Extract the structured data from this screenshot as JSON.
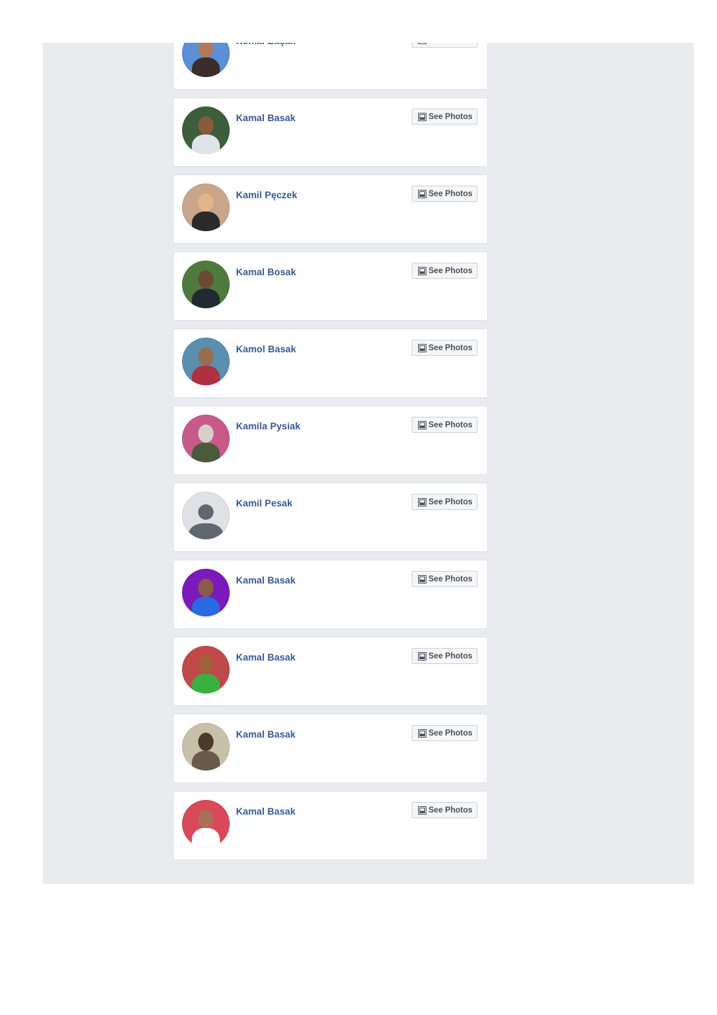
{
  "button_label": "See Photos",
  "results": [
    {
      "name": "Kemal Başak",
      "avatar": {
        "bg": "#5b8fd6",
        "head": "#b07a5a",
        "body": "#3a2e2c"
      }
    },
    {
      "name": "Kamal Basak",
      "avatar": {
        "bg": "#3d5e3a",
        "head": "#8a5a3c",
        "body": "#dfe4ea"
      }
    },
    {
      "name": "Kamil Pęczek",
      "avatar": {
        "bg": "#c9a58a",
        "head": "#e4b48a",
        "body": "#2a2a2a"
      }
    },
    {
      "name": "Kamal Bosak",
      "avatar": {
        "bg": "#4f7a3f",
        "head": "#6b4a33",
        "body": "#1f2a33"
      }
    },
    {
      "name": "Kamol Basak",
      "avatar": {
        "bg": "#5a8fb0",
        "head": "#9a6b4e",
        "body": "#b03040"
      }
    },
    {
      "name": "Kamila Pysiak",
      "avatar": {
        "bg": "#c85a8a",
        "head": "#d8d0c8",
        "body": "#4a5a3a"
      }
    },
    {
      "name": "Kamil Pesak",
      "avatar": {
        "bg": "#dfe1e5",
        "head": "#606770",
        "body": "#606770",
        "placeholder": true
      }
    },
    {
      "name": "Kamal Basak",
      "avatar": {
        "bg": "#7a1ab8",
        "head": "#8a5a4a",
        "body": "#2a6ae0"
      }
    },
    {
      "name": "Kamal Basak",
      "avatar": {
        "bg": "#c04a4a",
        "head": "#a0603a",
        "body": "#3ab040"
      }
    },
    {
      "name": "Kamal Basak",
      "avatar": {
        "bg": "#c8c0a8",
        "head": "#4a3a2a",
        "body": "#6a5a4a"
      }
    },
    {
      "name": "Kamal Basak",
      "avatar": {
        "bg": "#d84a5a",
        "head": "#a87058",
        "body": "#ffffff"
      }
    }
  ],
  "colors": {
    "link": "#365899",
    "page_bg": "#e9ebee",
    "card_border": "#dddfe2"
  },
  "icons": {
    "button_icon": "photo-icon"
  }
}
